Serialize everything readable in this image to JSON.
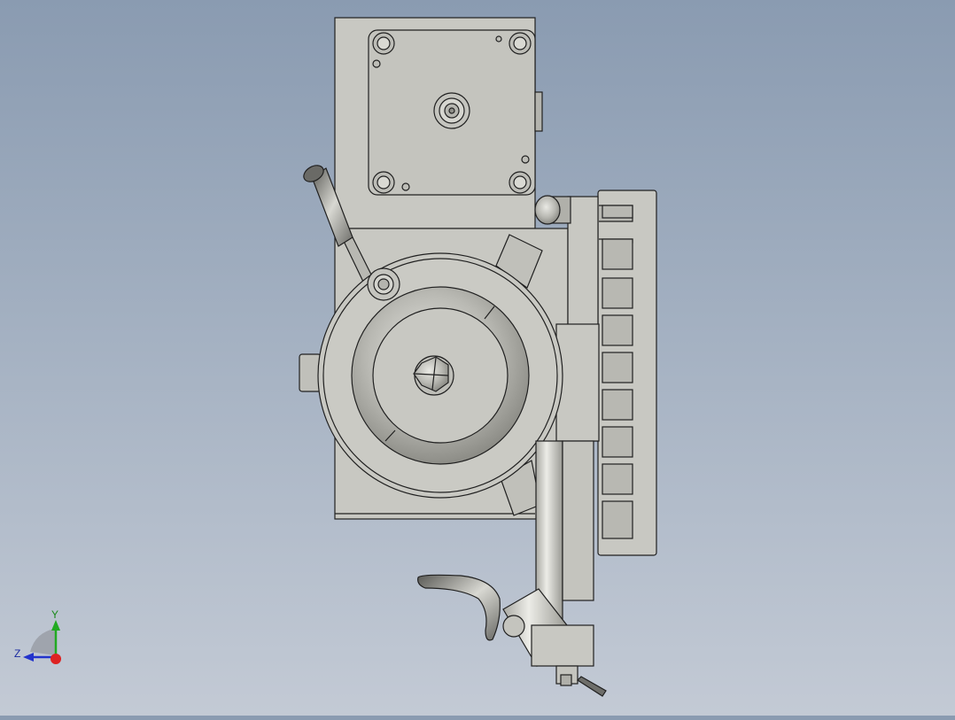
{
  "viewport": {
    "background_top": "#8a9bb1",
    "background_bottom": "#c3cad5",
    "part_color": "#c8c8c2",
    "edge_color": "#202020"
  },
  "triad": {
    "y_label": "Y",
    "z_label": "Z",
    "y_color": "#22aa22",
    "z_color": "#2233cc",
    "x_color": "#dd2222"
  }
}
